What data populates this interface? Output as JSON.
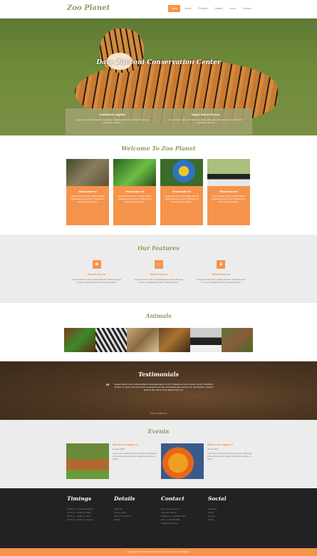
{
  "header": {
    "logo": "Zoo Planet",
    "nav": [
      "Home",
      "About",
      "Portfolio",
      "Gallery",
      "Icons",
      "Contact"
    ]
  },
  "hero": {
    "title": "Dave Zucconi Conservation Center",
    "cols": [
      {
        "heading": "Vestibulum sagittis",
        "text": "Lorem ipsum dolor sit amet consectetur adipiscing elit sed do eiusmod tempor incididunt ut labore."
      },
      {
        "heading": "Itaque Earum Rerum",
        "text": "Lorem ipsum dolor sit amet consectetur adipiscing elit sed do eiusmod tempor incididunt ut labore."
      }
    ]
  },
  "welcome": {
    "title": "Welcome To Zoo Planet",
    "cards": [
      {
        "heading": "Nescianda est",
        "text": "Integer lobortis metus ut ligula aliquam malesuada eget in lorem. Phasellus ac dolor ut ipsum pretium."
      },
      {
        "heading": "Nescianda est",
        "text": "Integer lobortis metus ut ligula aliquam malesuada eget in lorem. Phasellus ac dolor ut ipsum pretium."
      },
      {
        "heading": "Nescianda est",
        "text": "Integer lobortis metus ut ligula aliquam malesuada eget in lorem. Phasellus ac dolor ut ipsum pretium."
      },
      {
        "heading": "Nescianda est",
        "text": "Integer lobortis metus ut ligula aliquam malesuada eget in lorem. Phasellus ac dolor ut ipsum pretium."
      }
    ]
  },
  "features": {
    "title": "Our Features",
    "items": [
      {
        "icon": "camera-icon",
        "glyph": "◙",
        "heading": "Earum Rerum",
        "text": "Integer lobortis metus ut ligula aliquam malesuada eget in lorem. Phasellus ac dolor ut ipsum pretium."
      },
      {
        "icon": "tv-icon",
        "glyph": "▭",
        "heading": "Itaque Earum",
        "text": "Integer lobortis metus ut ligula aliquam malesuada eget in lorem. Phasellus ac dolor ut ipsum pretium."
      },
      {
        "icon": "user-icon",
        "glyph": "♟",
        "heading": "Nescianda est",
        "text": "Integer lobortis metus ut ligula aliquam malesuada eget in lorem. Phasellus ac dolor ut ipsum pretium."
      }
    ]
  },
  "animals": {
    "title": "Animals"
  },
  "testimonials": {
    "title": "Testimonials",
    "text": "Integer lobortis metus ut ligula aliquam malesuada eget in lorem. Phasellus ac dolor ut ipsum pretium sollicitudin. Aenean nec dolor non lorem iaculis consequat at vel erat. Sed pellentesque semper sem quis faucibus. Vivamus placerat arcu nisl id rutrum ligula tempor non.",
    "author": "John Anderson"
  },
  "events": {
    "title": "Events",
    "items": [
      {
        "heading": "Mauris nec magna ut",
        "date": "15 Aug 2016",
        "text": "Lorem ipsum dolor sit amet consectetur adipiscing elit sed do eiusmod tempor incididunt ut labore et dolore."
      },
      {
        "heading": "Mauris nec magna ut",
        "date": "25 Jul 2016",
        "text": "Lorem ipsum dolor sit amet consectetur adipiscing elit sed do eiusmod tempor incididunt ut labore et dolore."
      }
    ]
  },
  "footer": {
    "timings": {
      "title": "Timings",
      "rows": [
        "09:00 am - 12:00 pm Feeding",
        "12:00 pm - 02:00 pm Safari",
        "02:00 pm - 04:00 pm Show",
        "04:00 pm - 06:00 pm Feeding"
      ]
    },
    "details": {
      "title": "Details",
      "rows": [
        "About Us",
        "Privacy Policy",
        "Terms & Conditions",
        "Gallery"
      ]
    },
    "contact": {
      "title": "Contact",
      "rows": [
        "123 Lorem Street, NY",
        "Mylanum Cost 56",
        "Telephone: +1 234 567 890",
        "FAX: +1 234 567 890",
        "info@example.com"
      ]
    },
    "social": {
      "title": "Social",
      "rows": [
        "Facebook",
        "Twitter",
        "Google+",
        "Vimeo"
      ]
    },
    "copyright": "Copyright © 2016 Zoo Planet. All rights reserved | Design by W3layouts"
  }
}
